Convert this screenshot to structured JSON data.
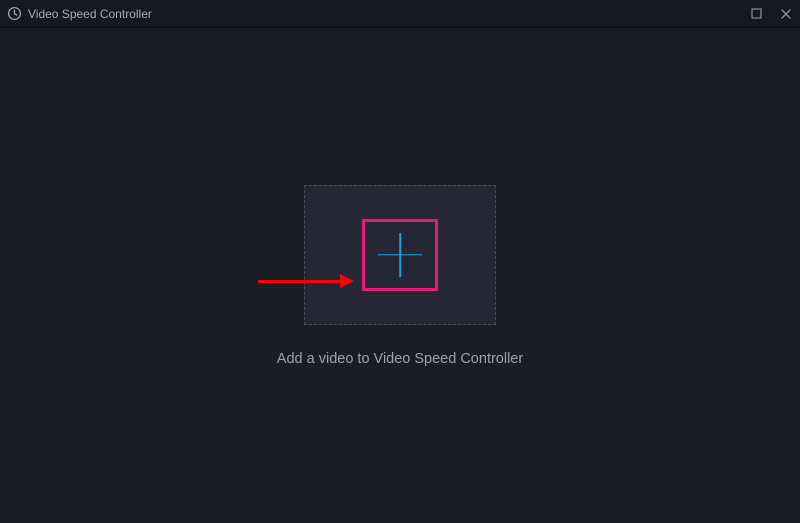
{
  "titlebar": {
    "app_title": "Video Speed Controller"
  },
  "main": {
    "caption": "Add a video to Video Speed Controller"
  },
  "annotation": {
    "highlight_color": "#e61a7a",
    "arrow_color": "#ff0000"
  },
  "icons": {
    "app": "clock-speed-icon",
    "plus": "plus-icon",
    "maximize": "maximize-icon",
    "close": "close-icon"
  }
}
